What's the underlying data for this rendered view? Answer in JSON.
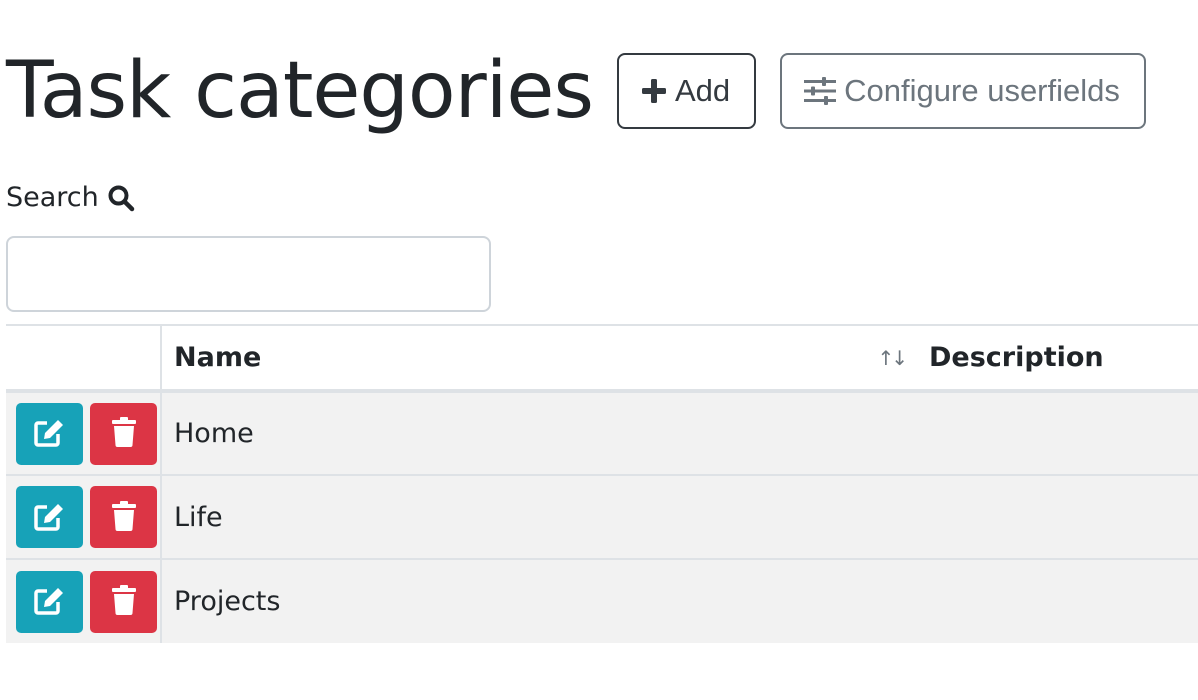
{
  "header": {
    "title": "Task categories",
    "add_label": "Add",
    "configure_label": "Configure userfields"
  },
  "search": {
    "label": "Search",
    "value": "",
    "placeholder": ""
  },
  "table": {
    "columns": [
      "",
      "Name",
      "Description"
    ],
    "sort_indicator": "↑↓",
    "rows": [
      {
        "name": "Home",
        "description": ""
      },
      {
        "name": "Life",
        "description": ""
      },
      {
        "name": "Projects",
        "description": ""
      }
    ]
  },
  "colors": {
    "edit": "#17a2b8",
    "delete": "#dc3545",
    "row_bg": "#f2f2f2"
  },
  "icons": {
    "add": "plus-icon",
    "configure": "sliders-icon",
    "search": "search-icon",
    "edit": "edit-icon",
    "delete": "trash-icon"
  }
}
